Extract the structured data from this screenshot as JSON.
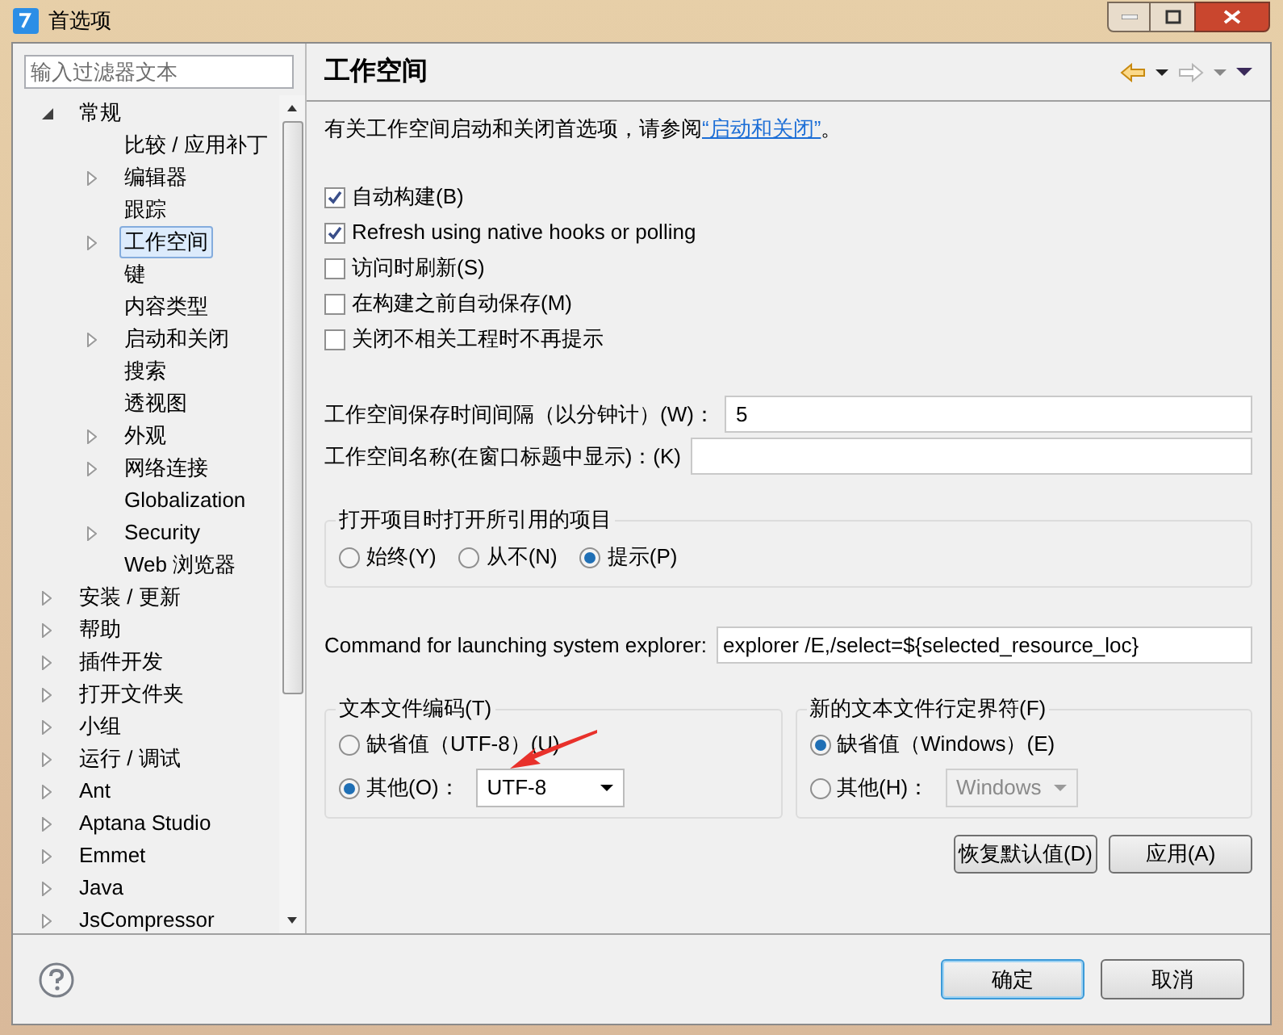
{
  "window": {
    "title": "首选项"
  },
  "filter": {
    "placeholder": "输入过滤器文本"
  },
  "tree": [
    {
      "label": "常规",
      "kind": "branch",
      "expanded": true,
      "selected": false,
      "children": [
        {
          "label": "比较 / 应用补丁",
          "kind": "leaf",
          "selected": false
        },
        {
          "label": "编辑器",
          "kind": "branch",
          "expanded": false,
          "selected": false
        },
        {
          "label": "跟踪",
          "kind": "leaf",
          "selected": false
        },
        {
          "label": "工作空间",
          "kind": "branch",
          "expanded": false,
          "selected": true
        },
        {
          "label": "键",
          "kind": "leaf",
          "selected": false
        },
        {
          "label": "内容类型",
          "kind": "leaf",
          "selected": false
        },
        {
          "label": "启动和关闭",
          "kind": "branch",
          "expanded": false,
          "selected": false
        },
        {
          "label": "搜索",
          "kind": "leaf",
          "selected": false
        },
        {
          "label": "透视图",
          "kind": "leaf",
          "selected": false
        },
        {
          "label": "外观",
          "kind": "branch",
          "expanded": false,
          "selected": false
        },
        {
          "label": "网络连接",
          "kind": "branch",
          "expanded": false,
          "selected": false
        },
        {
          "label": "Globalization",
          "kind": "leaf",
          "selected": false
        },
        {
          "label": "Security",
          "kind": "branch",
          "expanded": false,
          "selected": false
        },
        {
          "label": "Web 浏览器",
          "kind": "leaf",
          "selected": false
        }
      ]
    },
    {
      "label": "安装 / 更新",
      "kind": "branch",
      "expanded": false,
      "selected": false
    },
    {
      "label": "帮助",
      "kind": "branch",
      "expanded": false,
      "selected": false
    },
    {
      "label": "插件开发",
      "kind": "branch",
      "expanded": false,
      "selected": false
    },
    {
      "label": "打开文件夹",
      "kind": "branch",
      "expanded": false,
      "selected": false
    },
    {
      "label": "小组",
      "kind": "branch",
      "expanded": false,
      "selected": false
    },
    {
      "label": "运行 / 调试",
      "kind": "branch",
      "expanded": false,
      "selected": false
    },
    {
      "label": "Ant",
      "kind": "branch",
      "expanded": false,
      "selected": false
    },
    {
      "label": "Aptana Studio",
      "kind": "branch",
      "expanded": false,
      "selected": false
    },
    {
      "label": "Emmet",
      "kind": "branch",
      "expanded": false,
      "selected": false
    },
    {
      "label": "Java",
      "kind": "branch",
      "expanded": false,
      "selected": false
    },
    {
      "label": "JsCompressor",
      "kind": "branch",
      "expanded": false,
      "selected": false
    }
  ],
  "page": {
    "title": "工作空间",
    "description": "有关工作空间启动和关闭首选项，请参阅",
    "link": "“启动和关闭”",
    "description_end": "。"
  },
  "checkboxes": [
    {
      "label": "自动构建(B)",
      "checked": true
    },
    {
      "label": "Refresh using native hooks or polling",
      "checked": true
    },
    {
      "label": "访问时刷新(S)",
      "checked": false
    },
    {
      "label": "在构建之前自动保存(M)",
      "checked": false
    },
    {
      "label": "关闭不相关工程时不再提示",
      "checked": false
    }
  ],
  "fields": [
    {
      "label": "工作空间保存时间间隔（以分钟计）(W)：",
      "value": "5"
    },
    {
      "label": "工作空间名称(在窗口标题中显示)：(K)"
    }
  ],
  "open_referenced": {
    "title": "打开项目时打开所引用的项目",
    "options": [
      {
        "label": "始终(Y)",
        "selected": false
      },
      {
        "label": "从不(N)",
        "selected": false
      },
      {
        "label": "提示(P)",
        "selected": true
      }
    ]
  },
  "explorer_command": {
    "label": "Command for launching system explorer:",
    "value": "explorer /E,/select=${selected_resource_loc}"
  },
  "encoding": {
    "title": "文本文件编码(T)",
    "options": [
      {
        "label": "缺省值（UTF-8）(U)",
        "selected": false
      },
      {
        "label": "其他(O)：",
        "selected": true
      }
    ],
    "dropdown": {
      "value": "UTF-8",
      "disabled": false
    }
  },
  "line_delimiter": {
    "title": "新的文本文件行定界符(F)",
    "options": [
      {
        "label": "缺省值（Windows）(E)",
        "selected": true
      },
      {
        "label": "其他(H)：",
        "selected": false
      }
    ],
    "dropdown": {
      "value": "Windows",
      "disabled": true
    }
  },
  "page_buttons": [
    "恢复默认值(D)",
    "应用(A)"
  ],
  "dialog_buttons": [
    {
      "label": "确定",
      "default": true
    },
    {
      "label": "取消",
      "default": false
    }
  ]
}
